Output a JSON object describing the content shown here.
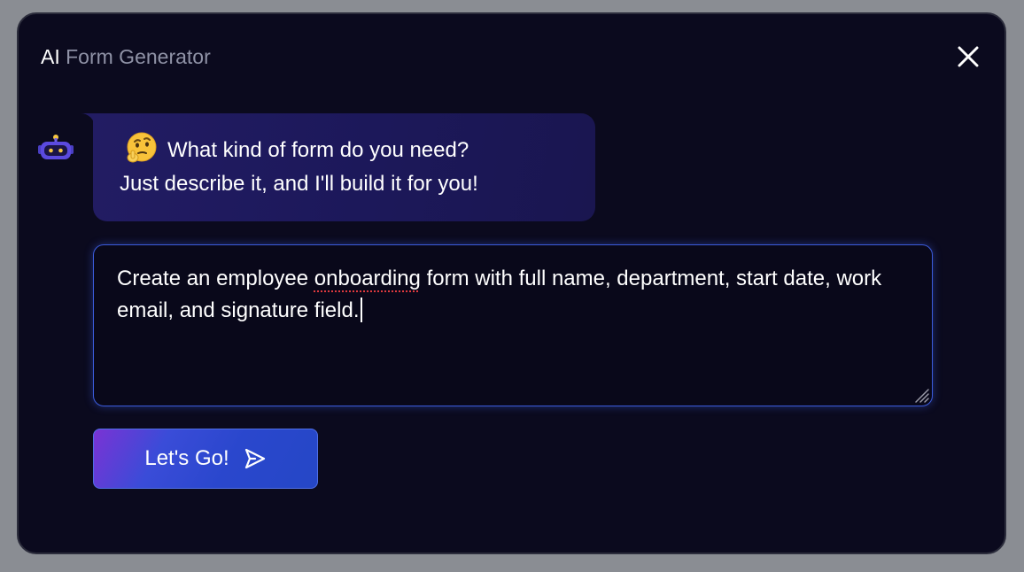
{
  "dialog": {
    "title_prefix": "AI",
    "title_rest": "Form Generator",
    "close_icon": "close-icon"
  },
  "assistant": {
    "avatar_icon": "robot-icon",
    "emoji_icon": "thinking-face-emoji",
    "message_line1": "What kind of form do you need?",
    "message_line2": "Just describe it, and I'll build it for you!"
  },
  "prompt": {
    "text_part1": "Create an employee ",
    "text_misspelled": "onboarding",
    "text_part2": " form with full name, department, start date, work email, and signature field."
  },
  "submit": {
    "label": "Let's Go!",
    "icon": "send-icon"
  },
  "colors": {
    "background": "#0b0a1e",
    "bubble": "#1e1a5e",
    "accent": "#3b5bdb",
    "button": "#2a47cd",
    "spellcheck": "#e0393e"
  }
}
